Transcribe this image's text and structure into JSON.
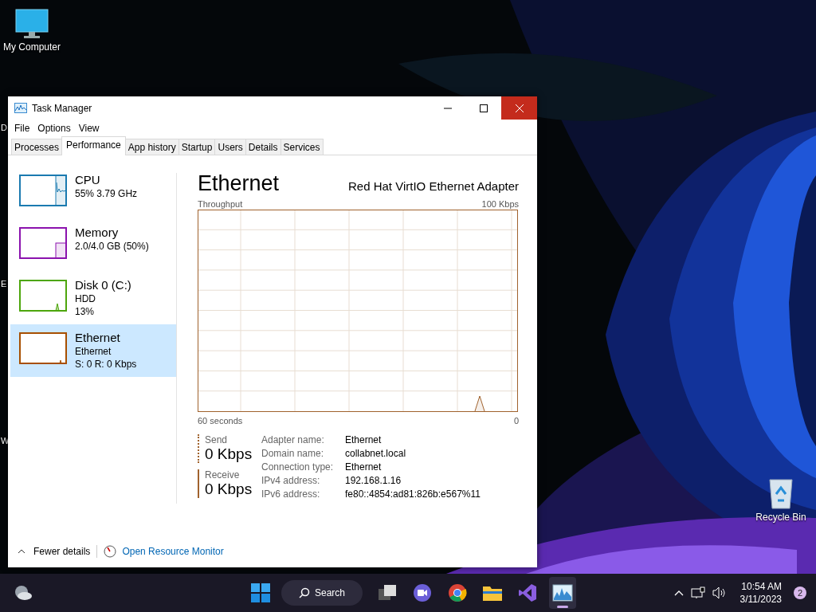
{
  "desktop_icons": [
    {
      "label": "My Computer",
      "kind": "computer"
    },
    {
      "label": "Recycle Bin",
      "kind": "recycle"
    }
  ],
  "desktop_cut_labels": [
    "D",
    "E",
    "W"
  ],
  "window": {
    "title": "Task Manager",
    "menu": [
      "File",
      "Options",
      "View"
    ],
    "tabs": [
      {
        "label": "Processes",
        "selected": false
      },
      {
        "label": "Performance",
        "selected": true
      },
      {
        "label": "App history",
        "selected": false
      },
      {
        "label": "Startup",
        "selected": false
      },
      {
        "label": "Users",
        "selected": false
      },
      {
        "label": "Details",
        "selected": false
      },
      {
        "label": "Services",
        "selected": false
      }
    ],
    "sidebar": [
      {
        "name": "CPU",
        "lines": [
          "55% 3.79 GHz"
        ],
        "kind": "cpu",
        "color": "#1a7ab0",
        "selected": false
      },
      {
        "name": "Memory",
        "lines": [
          "2.0/4.0 GB (50%)"
        ],
        "kind": "memory",
        "color": "#8b12ae",
        "selected": false
      },
      {
        "name": "Disk 0 (C:)",
        "lines": [
          "HDD",
          "13%"
        ],
        "kind": "disk",
        "color": "#4da60c",
        "selected": false
      },
      {
        "name": "Ethernet",
        "lines": [
          "Ethernet",
          "S: 0 R: 0 Kbps"
        ],
        "kind": "network",
        "color": "#a74f01",
        "selected": true
      }
    ],
    "detail": {
      "title": "Ethernet",
      "adapter": "Red Hat VirtIO Ethernet Adapter",
      "graph_label": "Throughput",
      "graph_max": "100 Kbps",
      "graph_time": "60 seconds",
      "graph_min": "0",
      "stats": [
        {
          "label": "Send",
          "value": "0 Kbps",
          "kind": "dashed"
        },
        {
          "label": "Receive",
          "value": "0 Kbps",
          "kind": "solid"
        }
      ],
      "properties": [
        {
          "label": "Adapter name:",
          "value": "Ethernet"
        },
        {
          "label": "Domain name:",
          "value": "collabnet.local"
        },
        {
          "label": "Connection type:",
          "value": "Ethernet"
        },
        {
          "label": "IPv4 address:",
          "value": "192.168.1.16"
        },
        {
          "label": "IPv6 address:",
          "value": "fe80::4854:ad81:826b:e567%11"
        }
      ]
    },
    "footer": {
      "fewer": "Fewer details",
      "monitor": "Open Resource Monitor"
    }
  },
  "taskbar": {
    "search": "Search",
    "time": "10:54 AM",
    "date": "3/11/2023",
    "notifications": "2",
    "apps": [
      {
        "kind": "taskview",
        "active": false
      },
      {
        "kind": "chat",
        "active": false
      },
      {
        "kind": "chrome",
        "active": false
      },
      {
        "kind": "folder",
        "active": false
      },
      {
        "kind": "studio",
        "active": false
      },
      {
        "kind": "taskmanager",
        "active": true
      }
    ]
  }
}
